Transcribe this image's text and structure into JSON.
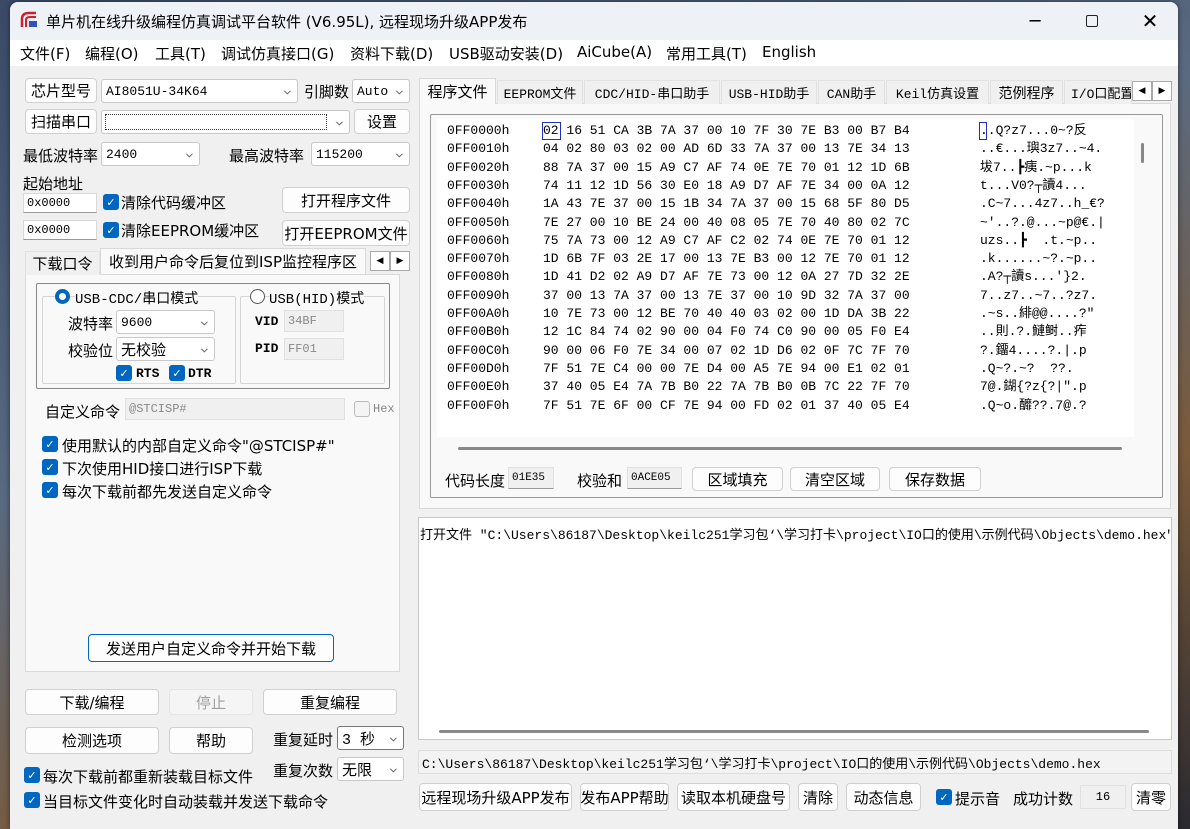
{
  "window": {
    "title": "单片机在线升级编程仿真调试平台软件 (V6.95L), 远程现场升级APP发布"
  },
  "menu": [
    "文件(F)",
    "编程(O)",
    "工具(T)",
    "调试仿真接口(G)",
    "资料下载(D)",
    "USB驱动安装(D)",
    "AiCube(A)",
    "常用工具(T)",
    "English"
  ],
  "left": {
    "chip_button": "芯片型号",
    "chip_value": "AI8051U-34K64",
    "pins_label": "引脚数",
    "pins_value": "Auto",
    "scan_button": "扫描串口",
    "port_value": "",
    "settings_button": "设置",
    "min_baud_label": "最低波特率",
    "min_baud_value": "2400",
    "max_baud_label": "最高波特率",
    "max_baud_value": "115200",
    "start_addr_label": "起始地址",
    "code_addr": "0x0000",
    "eeprom_addr": "0x0000",
    "clear_code_label": "清除代码缓冲区",
    "clear_eeprom_label": "清除EEPROM缓冲区",
    "open_program_button": "打开程序文件",
    "open_eeprom_button": "打开EEPROM文件",
    "tabs": [
      "下载口令",
      "收到用户命令后复位到ISP监控程序区"
    ],
    "cdc_mode_label": "USB-CDC/串口模式",
    "hid_mode_label": "USB(HID)模式",
    "baud_label": "波特率",
    "baud_value": "9600",
    "parity_label": "校验位",
    "parity_value": "无校验",
    "rts_label": "RTS",
    "dtr_label": "DTR",
    "vid_label": "VID",
    "vid_value": "34BF",
    "pid_label": "PID",
    "pid_value": "FF01",
    "custom_cmd_label": "自定义命令",
    "custom_cmd_value": "@STCISP#",
    "hex_label": "Hex",
    "opt1": "使用默认的内部自定义命令\"@STCISP#\"",
    "opt2": "下次使用HID接口进行ISP下载",
    "opt3": "每次下载前都先发送自定义命令",
    "send_button": "发送用户自定义命令并开始下载",
    "download_button": "下载/编程",
    "stop_button": "停止",
    "repeat_button": "重复编程",
    "detect_button": "检测选项",
    "help_button": "帮助",
    "repeat_delay_label": "重复延时",
    "repeat_delay_value": "3 秒",
    "repeat_count_label": "重复次数",
    "repeat_count_value": "无限",
    "reload_label": "每次下载前都重新装载目标文件",
    "auto_load_label": "当目标文件变化时自动装载并发送下载命令"
  },
  "right": {
    "tabs": [
      "程序文件",
      "EEPROM文件",
      "CDC/HID-串口助手",
      "USB-HID助手",
      "CAN助手",
      "Keil仿真设置",
      "范例程序",
      "I/O口配置"
    ],
    "hex_rows": [
      {
        "addr": "0FF0000h",
        "bytes": "02 16 51 CA 3B 7A 37 00 10 7F 30 7E B3 00 B7 B4",
        "ascii": "..Q?z7...0~?反"
      },
      {
        "addr": "0FF0010h",
        "bytes": "04 02 80 03 02 00 AD 6D 33 7A 37 00 13 7E 34 13",
        "ascii": "..€...璵3z7..~4."
      },
      {
        "addr": "0FF0020h",
        "bytes": "88 7A 37 00 15 A9 C7 AF 74 0E 7E 70 01 12 1D 6B",
        "ascii": "坺7..┣痍.~p...k"
      },
      {
        "addr": "0FF0030h",
        "bytes": "74 11 12 1D 56 30 E0 18 A9 D7 AF 7E 34 00 0A 12",
        "ascii": "t...V0?┬讀4..."
      },
      {
        "addr": "0FF0040h",
        "bytes": "1A 43 7E 37 00 15 1B 34 7A 37 00 15 68 5F 80 D5",
        "ascii": ".C~7...4z7..h_€?"
      },
      {
        "addr": "0FF0050h",
        "bytes": "7E 27 00 10 BE 24 00 40 08 05 7E 70 40 80 02 7C",
        "ascii": "~'..?.@...~p@€.|"
      },
      {
        "addr": "0FF0060h",
        "bytes": "75 7A 73 00 12 A9 C7 AF C2 02 74 0E 7E 70 01 12",
        "ascii": "uzs..┣  .t.~p.."
      },
      {
        "addr": "0FF0070h",
        "bytes": "1D 6B 7F 03 2E 17 00 13 7E B3 00 12 7E 70 01 12",
        "ascii": ".k......~?.~p.."
      },
      {
        "addr": "0FF0080h",
        "bytes": "1D 41 D2 02 A9 D7 AF 7E 73 00 12 0A 27 7D 32 2E",
        "ascii": ".A?┬讀s...'}2."
      },
      {
        "addr": "0FF0090h",
        "bytes": "37 00 13 7A 37 00 13 7E 37 00 10 9D 32 7A 37 00",
        "ascii": "7..z7..~7..?z7."
      },
      {
        "addr": "0FF00A0h",
        "bytes": "10 7E 73 00 12 BE 70 40 40 03 02 00 1D DA 3B 22",
        "ascii": ".~s..緋@@....?\""
      },
      {
        "addr": "0FF00B0h",
        "bytes": "12 1C 84 74 02 90 00 04 F0 74 C0 90 00 05 F0 E4",
        "ascii": "..則.?.鰱鲥..痄"
      },
      {
        "addr": "0FF00C0h",
        "bytes": "90 00 06 F0 7E 34 00 07 02 1D D6 02 0F 7C 7F 70",
        "ascii": "?.鐂4....?.|.p"
      },
      {
        "addr": "0FF00D0h",
        "bytes": "7F 51 7E C4 00 00 7E D4 00 A5 7E 94 00 E1 02 01",
        "ascii": ".Q~?.~?  ??."
      },
      {
        "addr": "0FF00E0h",
        "bytes": "37 40 05 E4 7A 7B B0 22 7A 7B B0 0B 7C 22 7F 70",
        "ascii": "7@.鍸{?z{?|\".p"
      },
      {
        "addr": "0FF00F0h",
        "bytes": "7F 51 7E 6F 00 CF 7E 94 00 FD 02 01 37 40 05 E4",
        "ascii": ".Q~o.釄??.7@.?"
      }
    ],
    "code_len_label": "代码长度",
    "code_len_value": "01E35",
    "checksum_label": "校验和",
    "checksum_value": "0ACE05",
    "fill_button": "区域填充",
    "clear_area_button": "清空区域",
    "save_button": "保存数据",
    "log_text": "打开文件 \"C:\\Users\\86187\\Desktop\\keilc251学习包‘\\学习打卡\\project\\IO口的使用\\示例代码\\Objects\\demo.hex\"",
    "path_value": "C:\\Users\\86187\\Desktop\\keilc251学习包‘\\学习打卡\\project\\IO口的使用\\示例代码\\Objects\\demo.hex",
    "publish_button": "远程现场升级APP发布",
    "publish_help_button": "发布APP帮助",
    "read_disk_button": "读取本机硬盘号",
    "clear_button": "清除",
    "dynamic_info_button": "动态信息",
    "beep_label": "提示音",
    "success_count_label": "成功计数",
    "success_count_value": "16",
    "reset_button": "清零"
  }
}
